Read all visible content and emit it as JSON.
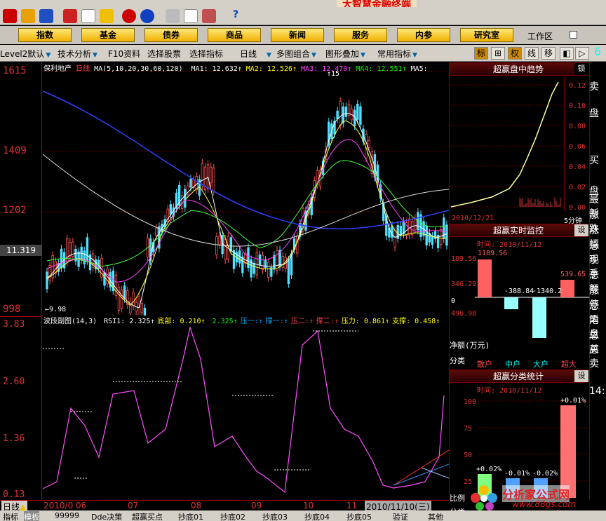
{
  "window": {
    "brand": "大智慧金融终端"
  },
  "menu": {
    "items": [
      "指数",
      "基金",
      "债券",
      "商品",
      "新闻",
      "服务",
      "内参",
      "研究室"
    ],
    "workarea": "工作区"
  },
  "funcbar": {
    "items": [
      "Level2默认",
      "技术分析",
      "F10资料",
      "选择股票",
      "选择指标",
      "日线",
      "多图组合",
      "图形叠加",
      "常用指标"
    ],
    "right_buttons": [
      "标",
      "⊞",
      "权",
      "线",
      "移"
    ]
  },
  "main_chart": {
    "stock_name": "保利地产",
    "period": "日线",
    "ma_params": "MA(5,10,20,30,60,120)",
    "ma_values": [
      {
        "name": "MA1",
        "value": "12.632",
        "color": "#ffffff"
      },
      {
        "name": "MA2",
        "value": "12.526",
        "color": "#ffff00"
      },
      {
        "name": "MA3",
        "value": "12.470",
        "color": "#ff44ff"
      },
      {
        "name": "MA4",
        "value": "12.551",
        "color": "#00ff00"
      },
      {
        "name": "MA5",
        "value": "",
        "color": "#ffffff"
      }
    ],
    "y_ticks": [
      "1615",
      "1409",
      "1202",
      "998"
    ],
    "current_price": "11.319",
    "annot_high": "15",
    "annot_low": "9.98"
  },
  "sub_chart": {
    "title": "波段副图(14,3)",
    "values": [
      {
        "label": "RSI1:",
        "value": "2.325",
        "color": "#ffffff"
      },
      {
        "label": "底部:",
        "value": "0.210",
        "color": "#ffff00"
      },
      {
        "label": "",
        "value": "2.325",
        "color": "#00ff00"
      },
      {
        "label": "压一:",
        "value": "",
        "color": "#00aaff"
      },
      {
        "label": "撑一:",
        "value": "",
        "color": "#00aaff"
      },
      {
        "label": "压二:",
        "value": "",
        "color": "#ff4444"
      },
      {
        "label": "撑二:",
        "value": "",
        "color": "#ff4444"
      },
      {
        "label": "压力:",
        "value": "0.861",
        "color": "#ffff00"
      },
      {
        "label": "支撑:",
        "value": "0.458",
        "color": "#ffff00"
      }
    ],
    "y_ticks": [
      "3.83",
      "2.60",
      "1.36",
      "0.13"
    ]
  },
  "date_axis": {
    "period_label": "日线",
    "labels": [
      "2010/0",
      "06",
      "07",
      "08",
      "09",
      "10",
      "11"
    ],
    "cursor_date": "2010/11/10(三)"
  },
  "right_panels": {
    "trend": {
      "title": "超赢盘中趋势",
      "lock": "锁",
      "y_ticks": [
        "0.12",
        "0.10",
        "0.08",
        "0.06",
        "0.04",
        "0.02",
        "0.00"
      ],
      "date": "2010/12/21",
      "period": "5分钟"
    },
    "monitor": {
      "title": "超赢实时监控",
      "setting": "设",
      "time": "时间: 2010/11/12",
      "y_ticks": [
        "189.56",
        "346.29",
        "0",
        "496.98"
      ],
      "values": [
        "1189.56",
        "-388.84",
        "-1340.2",
        "539.65"
      ],
      "net_label": "净额(万元)",
      "category_label": "分类",
      "categories": [
        "散户",
        "中户",
        "大户",
        "超大"
      ]
    },
    "classify": {
      "title": "超赢分类统计",
      "setting": "设",
      "time": "时间: 2010/11/12",
      "y_ticks": [
        "100",
        "75",
        "50",
        "25"
      ],
      "values": [
        "+0.02%",
        "-0.01%",
        "-0.02%",
        "+0.01%"
      ],
      "ratio_label": "比例",
      "category_label": "分类"
    }
  },
  "edge_labels": [
    "卖",
    "盘",
    "买",
    "盘",
    "最新",
    "涨跌",
    "涨幅",
    "总手",
    "现手",
    "总额",
    "涨停",
    "总笔",
    "内盘",
    "总买",
    "总卖",
    "14:"
  ],
  "tabs": [
    "指标",
    "模板",
    "99999",
    "Dde决策",
    "超赢买点",
    "抄底01",
    "抄底02",
    "抄底03",
    "抄底04",
    "抄底05",
    "验证",
    "其他"
  ],
  "watermark": {
    "title": "分析家公式网",
    "url": "www.88gs.com"
  }
}
